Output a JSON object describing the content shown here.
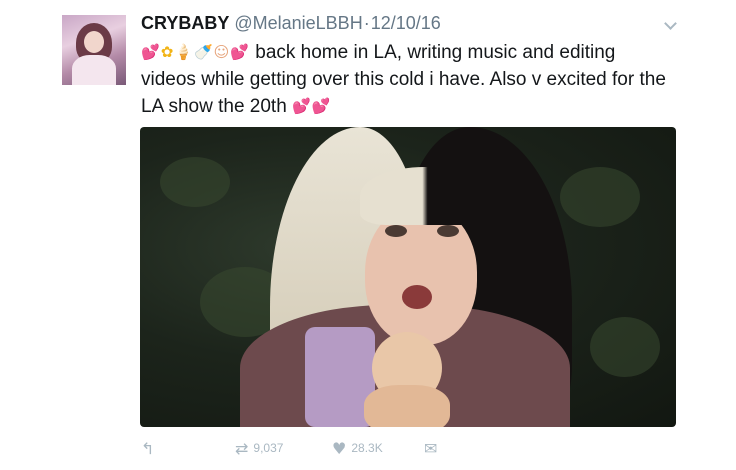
{
  "tweet": {
    "display_name": "CRYBABY",
    "handle": "@MelanieLBBH",
    "separator": "·",
    "date": "12/10/16",
    "text_line1": "back home in LA, writing music and editing",
    "text_line2": "videos while getting over this cold i have. Also v excited for the",
    "text_line3": "LA show the 20th",
    "emoji_lead": [
      "two-hearts",
      "sunflower",
      "ice-cream",
      "baby-bottle",
      "baby",
      "two-hearts"
    ],
    "emoji_tail": [
      "two-hearts",
      "two-hearts"
    ]
  },
  "actions": {
    "retweet_count": "9,037",
    "like_count": "28.3K"
  },
  "icons": {
    "reply": "reply-icon",
    "retweet": "retweet-icon",
    "like": "heart-icon",
    "dm": "envelope-icon",
    "more": "chevron-down-icon"
  },
  "colors": {
    "text": "#14171a",
    "muted": "#657786",
    "action": "#aab8c2",
    "emoji_heart": "#f05ba3"
  }
}
